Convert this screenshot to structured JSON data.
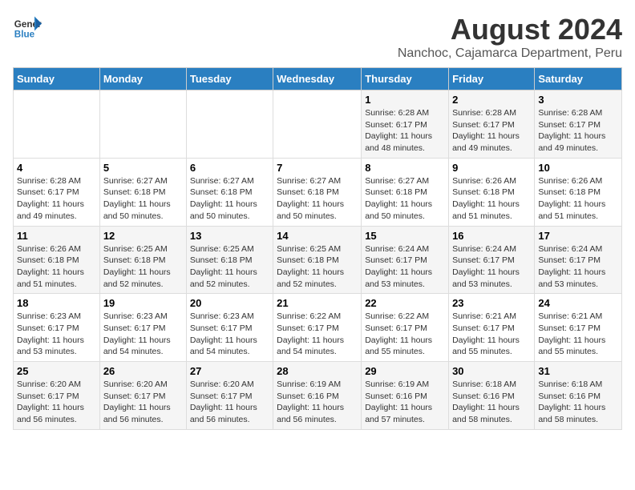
{
  "logo": {
    "line1": "General",
    "line2": "Blue"
  },
  "title": "August 2024",
  "subtitle": "Nanchoc, Cajamarca Department, Peru",
  "weekdays": [
    "Sunday",
    "Monday",
    "Tuesday",
    "Wednesday",
    "Thursday",
    "Friday",
    "Saturday"
  ],
  "weeks": [
    [
      {
        "day": "",
        "info": ""
      },
      {
        "day": "",
        "info": ""
      },
      {
        "day": "",
        "info": ""
      },
      {
        "day": "",
        "info": ""
      },
      {
        "day": "1",
        "info": "Sunrise: 6:28 AM\nSunset: 6:17 PM\nDaylight: 11 hours\nand 48 minutes."
      },
      {
        "day": "2",
        "info": "Sunrise: 6:28 AM\nSunset: 6:17 PM\nDaylight: 11 hours\nand 49 minutes."
      },
      {
        "day": "3",
        "info": "Sunrise: 6:28 AM\nSunset: 6:17 PM\nDaylight: 11 hours\nand 49 minutes."
      }
    ],
    [
      {
        "day": "4",
        "info": "Sunrise: 6:28 AM\nSunset: 6:17 PM\nDaylight: 11 hours\nand 49 minutes."
      },
      {
        "day": "5",
        "info": "Sunrise: 6:27 AM\nSunset: 6:18 PM\nDaylight: 11 hours\nand 50 minutes."
      },
      {
        "day": "6",
        "info": "Sunrise: 6:27 AM\nSunset: 6:18 PM\nDaylight: 11 hours\nand 50 minutes."
      },
      {
        "day": "7",
        "info": "Sunrise: 6:27 AM\nSunset: 6:18 PM\nDaylight: 11 hours\nand 50 minutes."
      },
      {
        "day": "8",
        "info": "Sunrise: 6:27 AM\nSunset: 6:18 PM\nDaylight: 11 hours\nand 50 minutes."
      },
      {
        "day": "9",
        "info": "Sunrise: 6:26 AM\nSunset: 6:18 PM\nDaylight: 11 hours\nand 51 minutes."
      },
      {
        "day": "10",
        "info": "Sunrise: 6:26 AM\nSunset: 6:18 PM\nDaylight: 11 hours\nand 51 minutes."
      }
    ],
    [
      {
        "day": "11",
        "info": "Sunrise: 6:26 AM\nSunset: 6:18 PM\nDaylight: 11 hours\nand 51 minutes."
      },
      {
        "day": "12",
        "info": "Sunrise: 6:25 AM\nSunset: 6:18 PM\nDaylight: 11 hours\nand 52 minutes."
      },
      {
        "day": "13",
        "info": "Sunrise: 6:25 AM\nSunset: 6:18 PM\nDaylight: 11 hours\nand 52 minutes."
      },
      {
        "day": "14",
        "info": "Sunrise: 6:25 AM\nSunset: 6:18 PM\nDaylight: 11 hours\nand 52 minutes."
      },
      {
        "day": "15",
        "info": "Sunrise: 6:24 AM\nSunset: 6:17 PM\nDaylight: 11 hours\nand 53 minutes."
      },
      {
        "day": "16",
        "info": "Sunrise: 6:24 AM\nSunset: 6:17 PM\nDaylight: 11 hours\nand 53 minutes."
      },
      {
        "day": "17",
        "info": "Sunrise: 6:24 AM\nSunset: 6:17 PM\nDaylight: 11 hours\nand 53 minutes."
      }
    ],
    [
      {
        "day": "18",
        "info": "Sunrise: 6:23 AM\nSunset: 6:17 PM\nDaylight: 11 hours\nand 53 minutes."
      },
      {
        "day": "19",
        "info": "Sunrise: 6:23 AM\nSunset: 6:17 PM\nDaylight: 11 hours\nand 54 minutes."
      },
      {
        "day": "20",
        "info": "Sunrise: 6:23 AM\nSunset: 6:17 PM\nDaylight: 11 hours\nand 54 minutes."
      },
      {
        "day": "21",
        "info": "Sunrise: 6:22 AM\nSunset: 6:17 PM\nDaylight: 11 hours\nand 54 minutes."
      },
      {
        "day": "22",
        "info": "Sunrise: 6:22 AM\nSunset: 6:17 PM\nDaylight: 11 hours\nand 55 minutes."
      },
      {
        "day": "23",
        "info": "Sunrise: 6:21 AM\nSunset: 6:17 PM\nDaylight: 11 hours\nand 55 minutes."
      },
      {
        "day": "24",
        "info": "Sunrise: 6:21 AM\nSunset: 6:17 PM\nDaylight: 11 hours\nand 55 minutes."
      }
    ],
    [
      {
        "day": "25",
        "info": "Sunrise: 6:20 AM\nSunset: 6:17 PM\nDaylight: 11 hours\nand 56 minutes."
      },
      {
        "day": "26",
        "info": "Sunrise: 6:20 AM\nSunset: 6:17 PM\nDaylight: 11 hours\nand 56 minutes."
      },
      {
        "day": "27",
        "info": "Sunrise: 6:20 AM\nSunset: 6:17 PM\nDaylight: 11 hours\nand 56 minutes."
      },
      {
        "day": "28",
        "info": "Sunrise: 6:19 AM\nSunset: 6:16 PM\nDaylight: 11 hours\nand 56 minutes."
      },
      {
        "day": "29",
        "info": "Sunrise: 6:19 AM\nSunset: 6:16 PM\nDaylight: 11 hours\nand 57 minutes."
      },
      {
        "day": "30",
        "info": "Sunrise: 6:18 AM\nSunset: 6:16 PM\nDaylight: 11 hours\nand 58 minutes."
      },
      {
        "day": "31",
        "info": "Sunrise: 6:18 AM\nSunset: 6:16 PM\nDaylight: 11 hours\nand 58 minutes."
      }
    ]
  ]
}
